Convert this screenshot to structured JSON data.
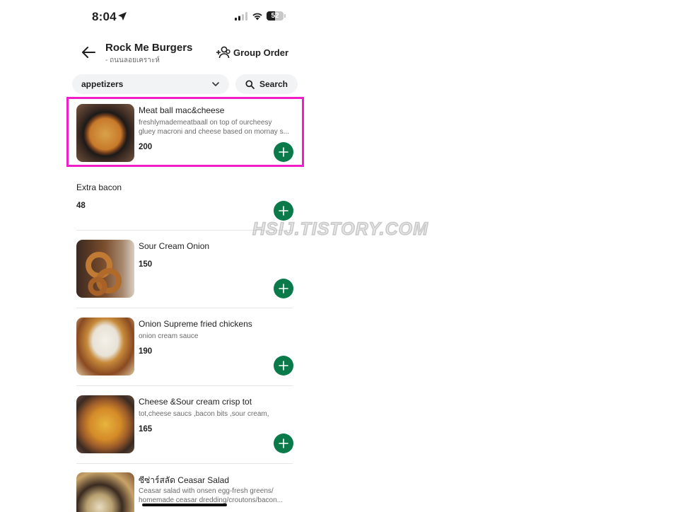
{
  "status_bar": {
    "time": "8:04",
    "battery": "52",
    "battery_level": 0.52
  },
  "header": {
    "restaurant_name": "Rock Me Burgers",
    "restaurant_subtitle": "- ถนนลอยเคราะห์",
    "group_order_label": "Group Order"
  },
  "filters": {
    "category": "appetizers",
    "search_label": "Search"
  },
  "items": [
    {
      "name": "Meat ball mac&cheese",
      "desc_line1": "freshlymademeatbaall on top of ourcheesy",
      "desc_line2": "gluey macroni and cheese based on mornay s...",
      "price": "200"
    },
    {
      "name": "Extra bacon",
      "price": "48"
    },
    {
      "name": "Sour Cream Onion",
      "price": "150"
    },
    {
      "name": "Onion Supreme fried chickens",
      "desc_line1": "onion cream sauce",
      "price": "190"
    },
    {
      "name": "Cheese &Sour cream crisp tot",
      "desc_line1": "tot,cheese saucs ,bacon bits ,sour cream,",
      "price": "165"
    },
    {
      "name": "ซีซ่าร์สลัด Ceasar Salad",
      "desc_line1": "Ceasar salad with onsen egg-fresh greens/",
      "desc_line2": "homemade ceasar dredding/croutons/bacon..."
    }
  ],
  "watermark": "HSIJ.TISTORY.COM",
  "colors": {
    "accent_green": "#0b7a4b",
    "highlight_pink": "#f01ec8"
  }
}
